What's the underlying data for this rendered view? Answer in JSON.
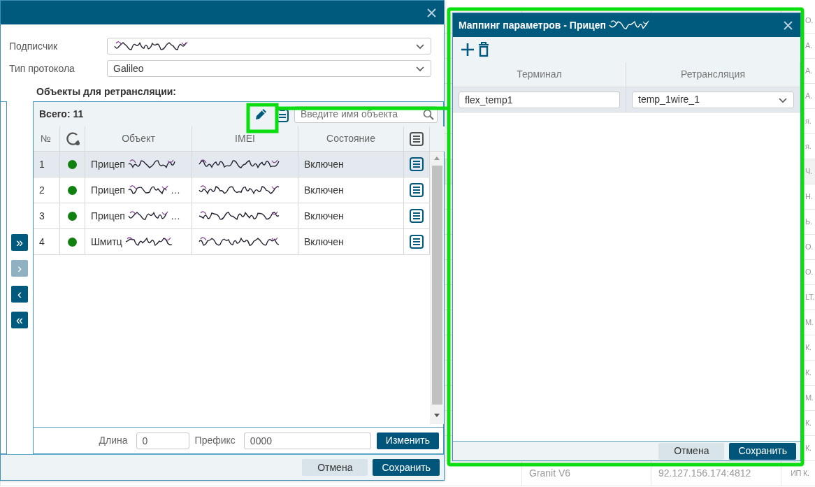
{
  "background_table": {
    "rows": [
      {
        "column_4": "О."
      },
      {
        "column_4": "А."
      },
      {
        "column_4": "А."
      },
      {
        "column_4": "А."
      },
      {
        "column_4": "я."
      },
      {
        "column_4": "я."
      },
      {
        "column_4": "Ч.",
        "selected": true
      },
      {
        "column_4": "Н."
      },
      {
        "column_4": "Ь."
      },
      {
        "column_4": "О."
      },
      {
        "column_4": "О."
      },
      {
        "column_4": "LT."
      },
      {
        "column_4": "М."
      },
      {
        "column_4": "К."
      },
      {
        "column_4": "К."
      },
      {
        "column_4": "М."
      },
      {
        "column_4": "К."
      },
      {
        "column_4": "К."
      },
      {
        "column_2": "Granit V6",
        "column_3": "92.127.156.174:4812",
        "column_4": "ИП К."
      }
    ]
  },
  "main_dialog": {
    "fields": [
      {
        "label": "Подписчик",
        "redacted": true
      },
      {
        "label": "Тип протокола",
        "value": "Galileo"
      }
    ],
    "objects_title": "Объекты для ретрансляции:",
    "total": "Всего: 11",
    "search": {
      "placeholder": "Введите имя объекта"
    },
    "columns": [
      {
        "kind": "text",
        "label": "№"
      },
      {
        "kind": "status"
      },
      {
        "kind": "text",
        "label": "Объект"
      },
      {
        "kind": "text",
        "label": "IMEI"
      },
      {
        "kind": "text",
        "label": "Состояние"
      },
      {
        "kind": "menu"
      }
    ],
    "rows": [
      {
        "number": "1",
        "color": "#108010",
        "object": "Прицеп",
        "state": "Включен",
        "selected": true
      },
      {
        "number": "2",
        "color": "#108010",
        "object": "Прицеп",
        "object_tail": "…",
        "state": "Включен",
        "selected": false
      },
      {
        "number": "3",
        "color": "#108010",
        "object": "Прицеп",
        "object_tail": "…",
        "state": "Включен",
        "selected": false
      },
      {
        "number": "4",
        "color": "#108010",
        "object": "Шмитц",
        "state": "Включен",
        "selected": false
      }
    ],
    "transfer_buttons": [
      {
        "label": "»",
        "disabled": false
      },
      {
        "label": "›",
        "disabled": true
      },
      {
        "label": "‹",
        "disabled": false
      },
      {
        "label": "«",
        "disabled": false
      }
    ],
    "footer_fields": [
      {
        "label": "Длина",
        "value": "0"
      },
      {
        "label": "Префикс",
        "value": "0000"
      }
    ],
    "apply_button": "Изменить",
    "buttons": [
      {
        "kind": "cancel",
        "label": "Отмена"
      },
      {
        "kind": "primary",
        "label": "Сохранить"
      }
    ]
  },
  "mapping_dialog": {
    "title": "Маппинг параметров - Прицеп",
    "columns": [
      "Терминал",
      "Ретрансляция"
    ],
    "rows": [
      {
        "terminal": "flex_temp1",
        "relay": "temp_1wire_1",
        "selected": true
      }
    ],
    "buttons": [
      {
        "kind": "cancel",
        "label": "Отмена"
      },
      {
        "kind": "primary",
        "label": "Сохранить"
      }
    ]
  }
}
